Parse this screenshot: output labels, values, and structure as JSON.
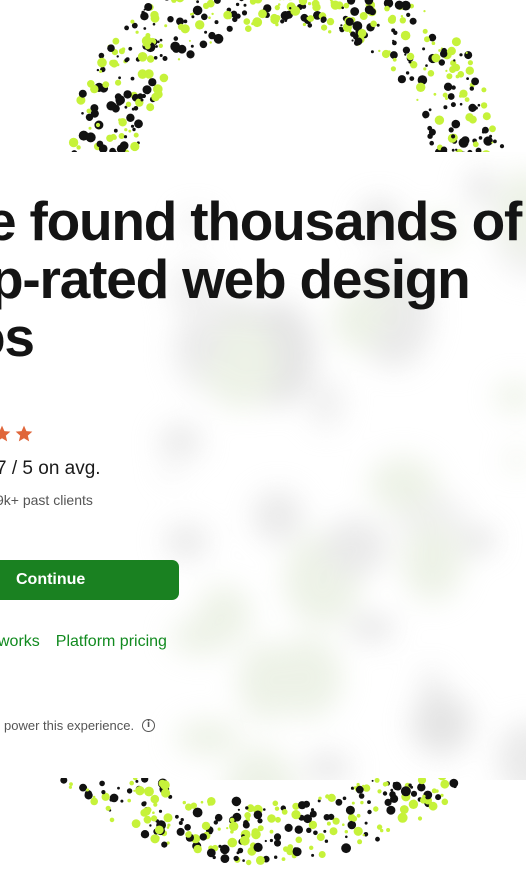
{
  "hero": {
    "headline_line1": "e found thousands of",
    "headline_line2": "p-rated web design",
    "headline_line3": "os"
  },
  "rating": {
    "stars_visible": 2,
    "star_color": "#e0663a",
    "value_text": "7 / 5 on avg.",
    "sub_text": "9k+ past clients"
  },
  "cta": {
    "continue_label": "Continue",
    "button_color": "#1a8121"
  },
  "links": {
    "how_it_works": "works",
    "platform_pricing": "Platform pricing",
    "link_color": "#118a1f"
  },
  "footer": {
    "disclaimer": "power this experience."
  },
  "decor": {
    "dot_colors": [
      "#111111",
      "#c6f23a"
    ]
  }
}
